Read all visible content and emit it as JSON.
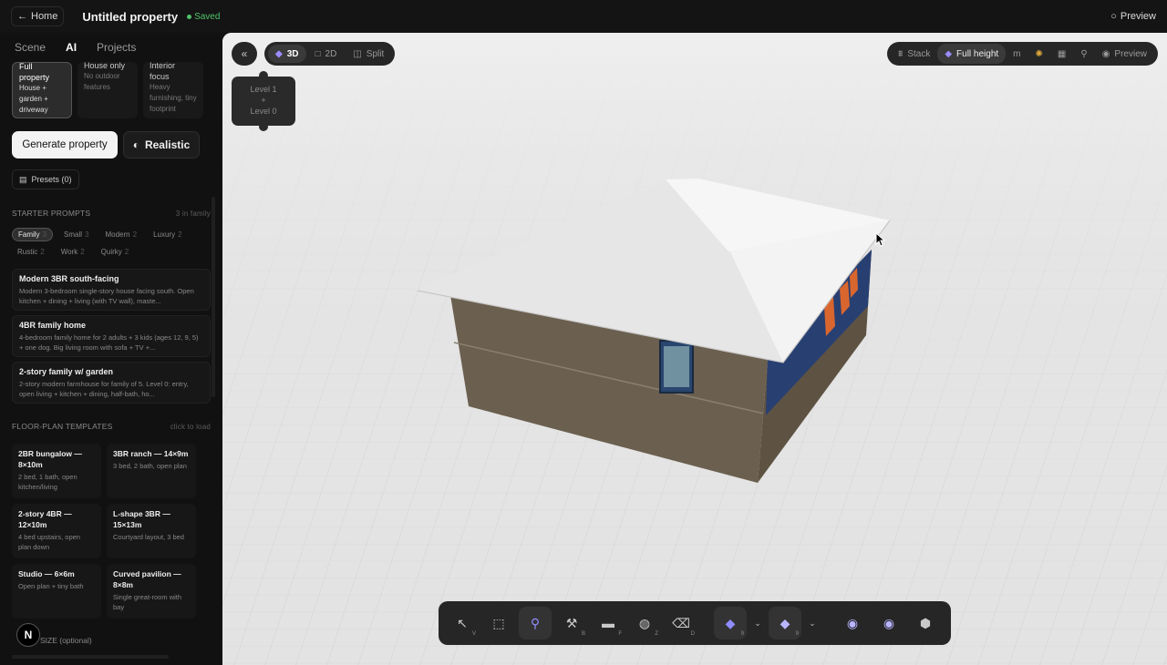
{
  "topbar": {
    "home_label": "Home",
    "title": "Untitled property",
    "saved_label": "Saved",
    "preview_label": "Preview"
  },
  "sidebar": {
    "tabs": [
      {
        "label": "Scene"
      },
      {
        "label": "AI"
      },
      {
        "label": "Projects"
      }
    ],
    "scope_cards": [
      {
        "title": "Full property",
        "desc": "House + garden + driveway"
      },
      {
        "title": "House only",
        "desc": "No outdoor features"
      },
      {
        "title": "Interior focus",
        "desc": "Heavy furnishing, tiny footprint"
      }
    ],
    "generate_label": "Generate property",
    "realistic_label": "Realistic",
    "presets_label": "Presets (0)",
    "starter_heading": "STARTER PROMPTS",
    "starter_meta": "3 in family",
    "chips": [
      {
        "label": "Family",
        "count": "3"
      },
      {
        "label": "Small",
        "count": "3"
      },
      {
        "label": "Modern",
        "count": "2"
      },
      {
        "label": "Luxury",
        "count": "2"
      },
      {
        "label": "Rustic",
        "count": "2"
      },
      {
        "label": "Work",
        "count": "2"
      },
      {
        "label": "Quirky",
        "count": "2"
      }
    ],
    "prompts": [
      {
        "title": "Modern 3BR south-facing",
        "desc": "Modern 3-bedroom single-story house facing south. Open kitchen + dining + living (with TV wall), maste..."
      },
      {
        "title": "4BR family home",
        "desc": "4-bedroom family home for 2 adults + 3 kids (ages 12, 9, 5) + one dog. Big living room with sofa + TV +..."
      },
      {
        "title": "2-story family w/ garden",
        "desc": "2-story modern farmhouse for family of 5. Level 0: entry, open living + kitchen + dining, half-bath, ho..."
      }
    ],
    "templates_heading": "FLOOR-PLAN TEMPLATES",
    "templates_meta": "click to load",
    "templates": [
      {
        "title": "2BR bungalow — 8×10m",
        "desc": "2 bed, 1 bath, open kitchen/living"
      },
      {
        "title": "3BR ranch — 14×9m",
        "desc": "3 bed, 2 bath, open plan"
      },
      {
        "title": "2-story 4BR — 12×10m",
        "desc": "4 bed upstairs, open plan down"
      },
      {
        "title": "L-shape 3BR — 15×13m",
        "desc": "Courtyard layout, 3 bed"
      },
      {
        "title": "Studio — 6×6m",
        "desc": "Open plan + tiny bath"
      },
      {
        "title": "Curved pavilion — 8×8m",
        "desc": "Single great-room with bay"
      }
    ],
    "footer_label": "SIZE (optional)",
    "badge": "N"
  },
  "viewport": {
    "modes": [
      {
        "label": "3D",
        "icon": "cube-icon"
      },
      {
        "label": "2D",
        "icon": "square-icon"
      },
      {
        "label": "Split",
        "icon": "split-icon"
      }
    ],
    "levels": [
      "Level 1",
      "+",
      "Level 0"
    ],
    "right_controls": [
      {
        "label": "Stack",
        "icon": "stack-icon"
      },
      {
        "label": "Full height",
        "icon": "layers-icon"
      },
      {
        "label": "m",
        "icon": ""
      },
      {
        "label": "",
        "icon": "sun-icon"
      },
      {
        "label": "",
        "icon": "building-icon"
      },
      {
        "label": "",
        "icon": "walk-icon"
      },
      {
        "label": "Preview",
        "icon": "eye-icon"
      }
    ],
    "tools": [
      {
        "name": "select-tool",
        "glyph": "↖",
        "key": "V"
      },
      {
        "name": "box-select-tool",
        "glyph": "⬚",
        "key": ""
      },
      {
        "name": "pin-tool",
        "glyph": "⚲",
        "key": ""
      },
      {
        "name": "build-tool",
        "glyph": "⚒",
        "key": "B"
      },
      {
        "name": "furnish-tool",
        "glyph": "▬",
        "key": "F"
      },
      {
        "name": "material-tool",
        "glyph": "◍",
        "key": "Z"
      },
      {
        "name": "delete-tool",
        "glyph": "🗑",
        "key": "D"
      },
      {
        "name": "floor-tool",
        "glyph": "◆",
        "key": "9"
      },
      {
        "name": "slab-tool",
        "glyph": "◆",
        "key": "9"
      },
      {
        "name": "camera-up-tool",
        "glyph": "◉",
        "key": ""
      },
      {
        "name": "camera-orbit-tool",
        "glyph": "◉",
        "key": ""
      },
      {
        "name": "camera-lock-tool",
        "glyph": "⬢",
        "key": ""
      }
    ]
  },
  "colors": {
    "accent_green": "#4fc36b",
    "roof": "#f1f1f1",
    "wall": "#6a5e4e",
    "window_frame": "#1e3c7a",
    "orange_panel": "#d9662e"
  }
}
